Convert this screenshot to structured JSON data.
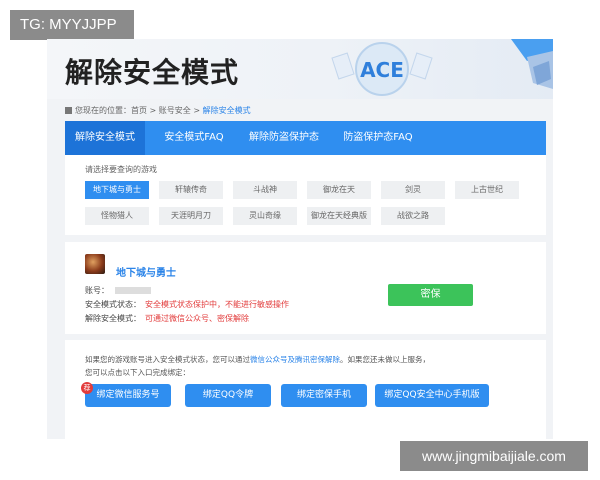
{
  "watermark_top": "TG: MYYJJPP",
  "watermark_bottom": "www.jingmibaijiale.com",
  "page": {
    "title": "解除安全模式",
    "logo_text": "ACE",
    "breadcrumb": {
      "prefix": "您现在的位置：",
      "home": "首页",
      "sep1": " > ",
      "section": "账号安全",
      "sep2": " > ",
      "current": "解除安全模式"
    },
    "tabs": [
      {
        "label": "解除安全模式"
      },
      {
        "label": "安全模式FAQ"
      },
      {
        "label": "解除防盗保护态"
      },
      {
        "label": "防盗保护态FAQ"
      }
    ],
    "games_prompt": "请选择要查询的游戏",
    "games": [
      {
        "label": "地下城与勇士"
      },
      {
        "label": "轩辕传奇"
      },
      {
        "label": "斗战神"
      },
      {
        "label": "御龙在天"
      },
      {
        "label": "剑灵"
      },
      {
        "label": "上古世纪"
      },
      {
        "label": "怪物猎人"
      },
      {
        "label": "天涯明月刀"
      },
      {
        "label": "灵山奇缘"
      },
      {
        "label": "御龙在天经典版"
      },
      {
        "label": "战欲之路"
      }
    ],
    "selected_game": {
      "name": "地下城与勇士",
      "account_label": "账号：",
      "status_label": "安全模式状态：",
      "status_value": "安全模式状态保护中，不能进行敏感操作",
      "unlock_label": "解除安全模式：",
      "unlock_value": "可通过微信公众号、密保解除",
      "button": "密保"
    },
    "info_line1_a": "如果您的游戏账号进入安全模式状态，您可以通过",
    "info_line1_link": "微信公众号及腾讯密保解除",
    "info_line1_b": "。如果您还未做以上服务，",
    "info_line2": "您可以点击以下入口完成绑定：",
    "badge": "荐",
    "bind_buttons": [
      {
        "label": "绑定微信服务号"
      },
      {
        "label": "绑定QQ令牌"
      },
      {
        "label": "绑定密保手机"
      },
      {
        "label": "绑定QQ安全中心手机版"
      }
    ]
  }
}
